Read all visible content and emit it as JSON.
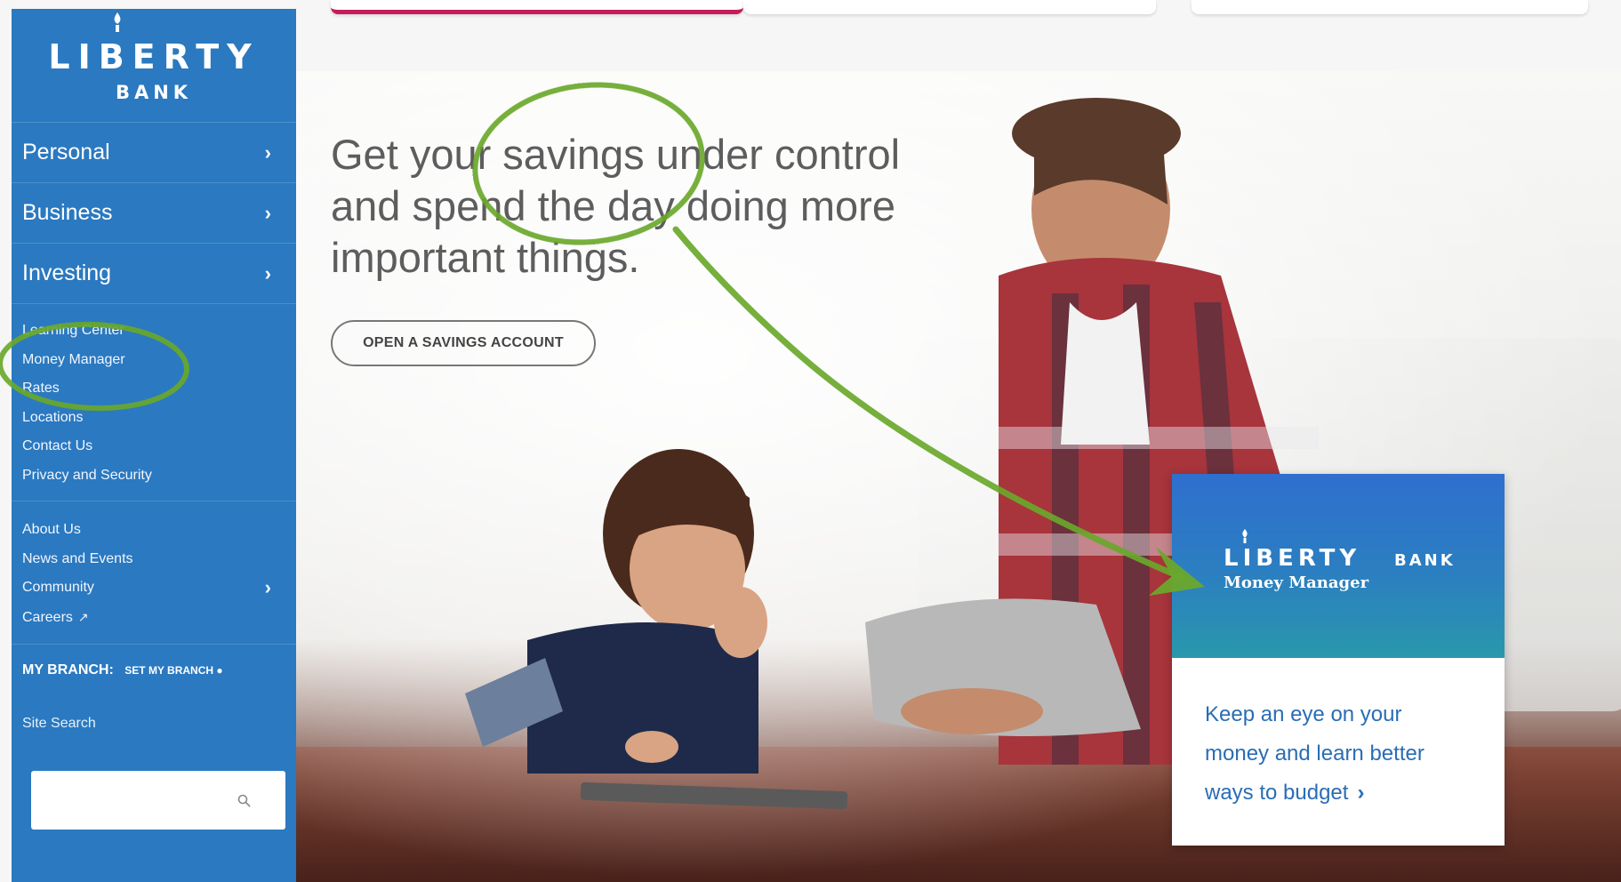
{
  "brand": {
    "logo_word": "LIBERTY",
    "logo_sub": "BANK"
  },
  "sidebar": {
    "main_items": [
      {
        "label": "Personal"
      },
      {
        "label": "Business"
      },
      {
        "label": "Investing"
      }
    ],
    "links": [
      {
        "label": "Learning Center"
      },
      {
        "label": "Money Manager"
      },
      {
        "label": "Rates"
      },
      {
        "label": "Locations"
      },
      {
        "label": "Contact Us"
      },
      {
        "label": "Privacy and Security"
      }
    ],
    "links2": [
      {
        "label": "About Us"
      },
      {
        "label": "News and Events"
      },
      {
        "label": "Community"
      },
      {
        "label": "Careers"
      }
    ],
    "branch_label": "MY BRANCH:",
    "set_branch": "SET MY BRANCH",
    "search_label": "Site Search",
    "search_value": ""
  },
  "hero": {
    "headline_line1": "Get your savings under control",
    "headline_line2": "and spend the day doing more",
    "headline_line3": "important things.",
    "cta_label": "OPEN A SAVINGS ACCOUNT"
  },
  "money_manager_card": {
    "logo_word": "LIBERTY",
    "logo_bank": "BANK",
    "subtitle": "Money Manager",
    "line1": "Keep an eye on your",
    "line2": "money and learn better",
    "line3": "ways to budget"
  },
  "colors": {
    "sidebar": "#2b79c0",
    "accent_bar": "#c41d5b",
    "annotation": "#6aa82b",
    "card_link": "#2a6db5"
  }
}
